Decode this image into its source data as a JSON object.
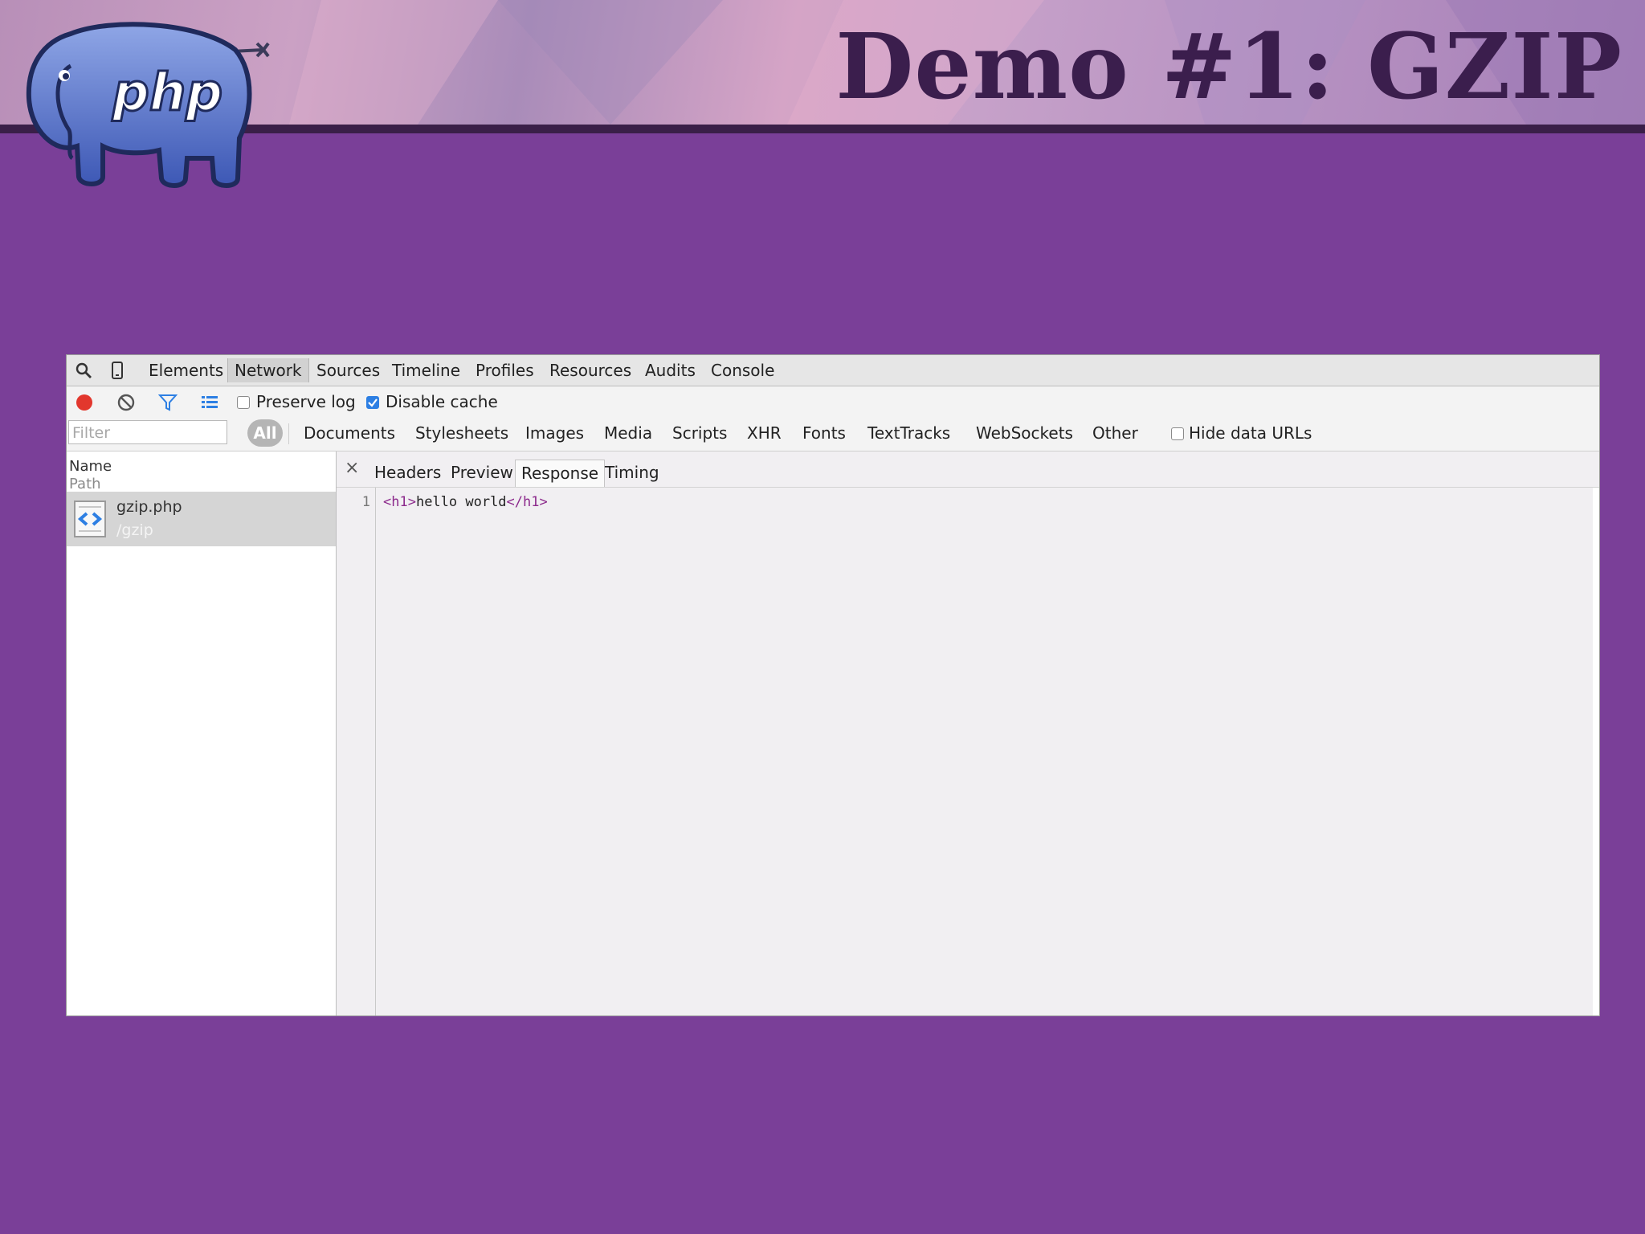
{
  "slide": {
    "title": "Demo #1: GZIP",
    "logo_text": "php"
  },
  "devtools": {
    "main_tabs": [
      "Elements",
      "Network",
      "Sources",
      "Timeline",
      "Profiles",
      "Resources",
      "Audits",
      "Console"
    ],
    "active_tab": "Network",
    "toolbar": {
      "preserve_log": {
        "label": "Preserve log",
        "checked": false
      },
      "disable_cache": {
        "label": "Disable cache",
        "checked": true
      }
    },
    "filter": {
      "placeholder": "Filter",
      "all_label": "All",
      "types": [
        "Documents",
        "Stylesheets",
        "Images",
        "Media",
        "Scripts",
        "XHR",
        "Fonts",
        "TextTracks",
        "WebSockets",
        "Other"
      ],
      "hide_data_urls": {
        "label": "Hide data URLs",
        "checked": false
      }
    },
    "requests_pane": {
      "col_name": "Name",
      "col_path": "Path",
      "requests": [
        {
          "name": "gzip.php",
          "path": "/gzip"
        }
      ]
    },
    "details": {
      "close": "×",
      "tabs": [
        "Headers",
        "Preview",
        "Response",
        "Timing"
      ],
      "active_tab": "Response",
      "response": {
        "line_number": "1",
        "open_tag": "<h1>",
        "text": "hello world",
        "close_tag": "</h1>"
      }
    }
  },
  "colors": {
    "slide_background": "#7a3f98",
    "title_color": "#3b1e4d",
    "record_red": "#e2372d",
    "accent_blue": "#2d7fe3"
  }
}
